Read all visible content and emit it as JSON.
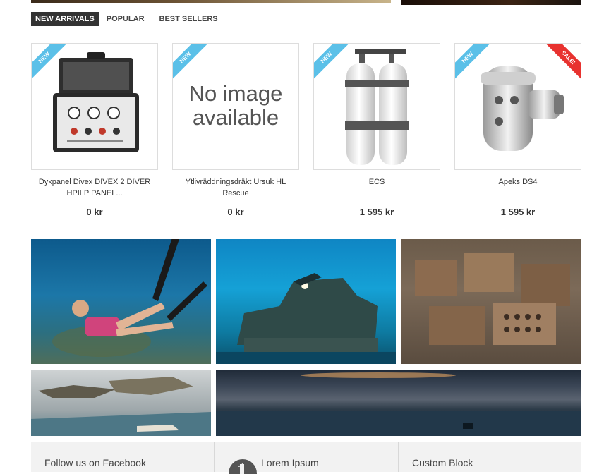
{
  "tabs": [
    "NEW ARRIVALS",
    "POPULAR",
    "BEST SELLERS"
  ],
  "badges": {
    "new": "NEW",
    "sale": "SALE!"
  },
  "no_image_text": "No image available",
  "products": [
    {
      "name": "Dykpanel Divex DIVEX 2 DIVER HPILP PANEL...",
      "price": "0 kr"
    },
    {
      "name": "Ytlivräddningsdräkt Ursuk HL Rescue",
      "price": "0 kr"
    },
    {
      "name": "ECS",
      "price": "1 595 kr"
    },
    {
      "name": "Apeks DS4",
      "price": "1 595 kr"
    }
  ],
  "footer": {
    "facebook_title": "Follow us on Facebook",
    "block2_title": "Lorem Ipsum",
    "block3_title": "Custom Block"
  },
  "colors": {
    "new_badge": "#5bc0e8",
    "sale_badge": "#e8322f",
    "active_tab": "#333333"
  }
}
